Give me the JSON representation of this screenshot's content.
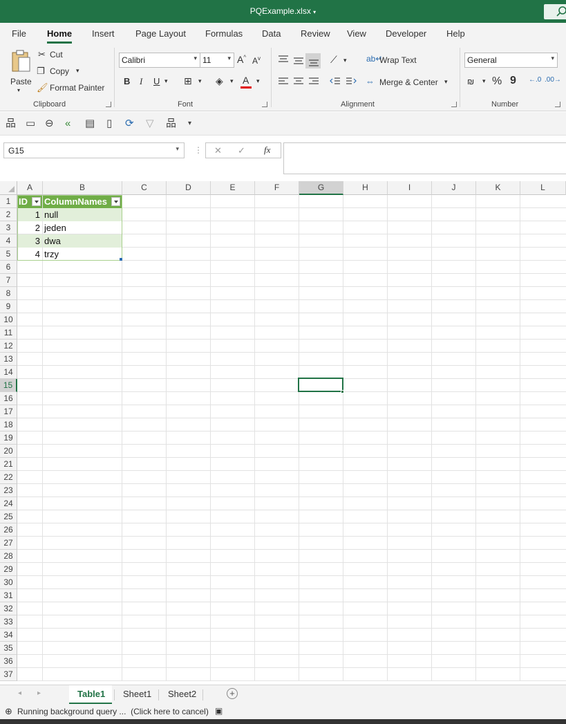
{
  "window": {
    "title": "PQExample.xlsx"
  },
  "tabs": [
    "File",
    "Home",
    "Insert",
    "Page Layout",
    "Formulas",
    "Data",
    "Review",
    "View",
    "Developer",
    "Help"
  ],
  "ribbon": {
    "clipboard": {
      "paste": "Paste",
      "cut": "Cut",
      "copy": "Copy",
      "format_painter": "Format Painter",
      "label": "Clipboard"
    },
    "font": {
      "name": "Calibri",
      "size": "11",
      "grow": "A",
      "shrink": "A",
      "bold": "B",
      "italic": "I",
      "underline": "U",
      "color_letter": "A",
      "label": "Font",
      "font_color": "#e00000"
    },
    "alignment": {
      "wrap": "Wrap Text",
      "merge": "Merge & Center",
      "label": "Alignment"
    },
    "number": {
      "format": "General",
      "percent": "%",
      "comma": "9",
      "label": "Number"
    }
  },
  "formula_bar": {
    "name_box": "G15",
    "fx": "fx",
    "cancel": "✕",
    "enter": "✓",
    "formula": ""
  },
  "columns": [
    "A",
    "B",
    "C",
    "D",
    "E",
    "F",
    "G",
    "H",
    "I",
    "J",
    "K",
    "L"
  ],
  "rows": [
    "1",
    "2",
    "3",
    "4",
    "5",
    "6",
    "7",
    "8",
    "9",
    "10",
    "11",
    "12",
    "13",
    "14",
    "15",
    "16",
    "17",
    "18",
    "19",
    "20",
    "21",
    "22",
    "23",
    "24",
    "25",
    "26",
    "27",
    "28",
    "29",
    "30",
    "31",
    "32",
    "33",
    "34",
    "35",
    "36",
    "37"
  ],
  "selected": {
    "column": "G",
    "row": "15"
  },
  "table": {
    "headers": [
      "ID",
      "ColumnNames"
    ],
    "rows": [
      {
        "id": "1",
        "name": "null"
      },
      {
        "id": "2",
        "name": "jeden"
      },
      {
        "id": "3",
        "name": "dwa"
      },
      {
        "id": "4",
        "name": "trzy"
      }
    ],
    "header_color": "#70ad47",
    "band_color": "#e2efda"
  },
  "sheets": [
    "Table1",
    "Sheet1",
    "Sheet2"
  ],
  "active_sheet": "Table1",
  "status": {
    "text": "Running background query ...  (Click here to cancel)"
  }
}
